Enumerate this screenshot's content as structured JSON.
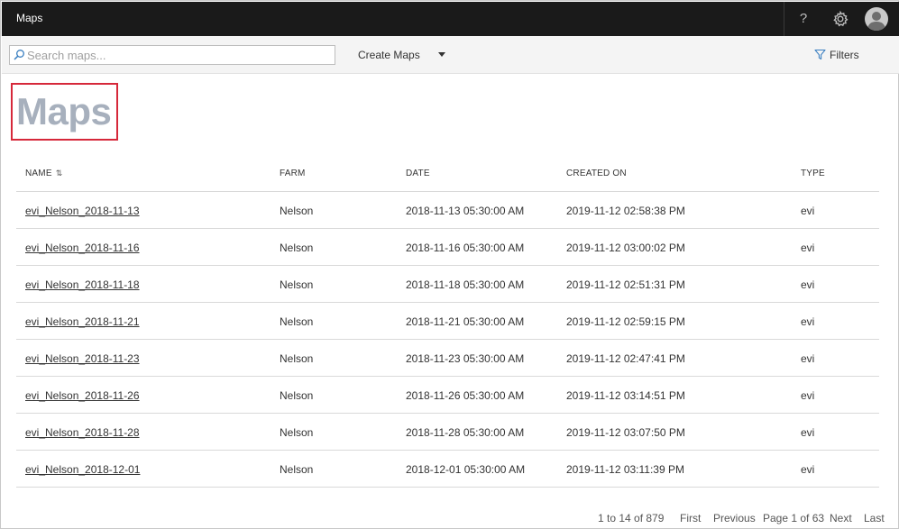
{
  "app": {
    "title": "Maps"
  },
  "header": {
    "help_label": "?"
  },
  "toolbar": {
    "search_placeholder": "Search maps...",
    "search_value": "",
    "create_label": "Create Maps",
    "filters_label": "Filters"
  },
  "page": {
    "title": "Maps"
  },
  "table": {
    "columns": {
      "name": "NAME",
      "farm": "FARM",
      "date": "DATE",
      "created": "CREATED ON",
      "type": "TYPE"
    },
    "rows": [
      {
        "name": "evi_Nelson_2018-11-13",
        "farm": "Nelson",
        "date": "2018-11-13 05:30:00 AM",
        "created": "2019-11-12 02:58:38 PM",
        "type": "evi"
      },
      {
        "name": "evi_Nelson_2018-11-16",
        "farm": "Nelson",
        "date": "2018-11-16 05:30:00 AM",
        "created": "2019-11-12 03:00:02 PM",
        "type": "evi"
      },
      {
        "name": "evi_Nelson_2018-11-18",
        "farm": "Nelson",
        "date": "2018-11-18 05:30:00 AM",
        "created": "2019-11-12 02:51:31 PM",
        "type": "evi"
      },
      {
        "name": "evi_Nelson_2018-11-21",
        "farm": "Nelson",
        "date": "2018-11-21 05:30:00 AM",
        "created": "2019-11-12 02:59:15 PM",
        "type": "evi"
      },
      {
        "name": "evi_Nelson_2018-11-23",
        "farm": "Nelson",
        "date": "2018-11-23 05:30:00 AM",
        "created": "2019-11-12 02:47:41 PM",
        "type": "evi"
      },
      {
        "name": "evi_Nelson_2018-11-26",
        "farm": "Nelson",
        "date": "2018-11-26 05:30:00 AM",
        "created": "2019-11-12 03:14:51 PM",
        "type": "evi"
      },
      {
        "name": "evi_Nelson_2018-11-28",
        "farm": "Nelson",
        "date": "2018-11-28 05:30:00 AM",
        "created": "2019-11-12 03:07:50 PM",
        "type": "evi"
      },
      {
        "name": "evi_Nelson_2018-12-01",
        "farm": "Nelson",
        "date": "2018-12-01 05:30:00 AM",
        "created": "2019-11-12 03:11:39 PM",
        "type": "evi"
      }
    ]
  },
  "pagination": {
    "range": "1 to 14 of 879",
    "first": "First",
    "previous": "Previous",
    "page": "Page 1 of 63",
    "next": "Next",
    "last": "Last"
  },
  "icons": {
    "help": "help-icon",
    "settings": "gear-icon",
    "avatar": "user-avatar-icon",
    "search": "search-icon",
    "dropdown": "chevron-down-icon",
    "filter": "filter-icon",
    "sort": "sort-icon"
  },
  "colors": {
    "topbar_bg": "#1a1a1a",
    "toolbar_bg": "#f4f4f4",
    "title_color": "#a7b0bd",
    "highlight_border": "#d6283a",
    "filter_icon": "#3a7fc1",
    "search_icon": "#3a7fc1"
  }
}
